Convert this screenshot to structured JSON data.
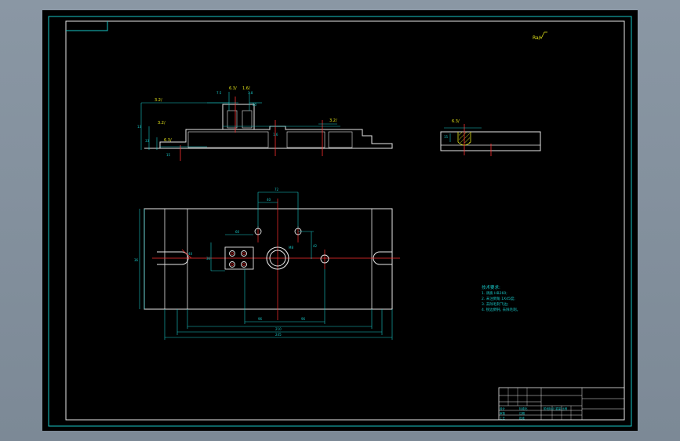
{
  "drawing": {
    "roughness_note": "Ra/",
    "section": {
      "dims": [
        "7.5",
        "3.8",
        "13",
        "33",
        "15",
        "20",
        "1.6"
      ],
      "roughness": [
        "3.2/",
        "3.2/",
        "6.3/",
        "6.3/",
        "1.6/",
        "3.2/"
      ]
    },
    "side_view": {
      "roughness": "6.3/",
      "dim": "15"
    },
    "plan": {
      "dims_top": [
        "72",
        "40"
      ],
      "dims_left": [
        "36",
        "36",
        "60"
      ],
      "dims_right": [
        "42"
      ],
      "dims_bottom": [
        "96",
        "96",
        "210",
        "245"
      ],
      "hole_labels": [
        "4X",
        "M8"
      ]
    },
    "notes": {
      "title": "技术要求:",
      "items": [
        "1. 调质 HB260;",
        "2. 未注倒角 1X45度;",
        "3. 去除毛刺飞边;",
        "4. 锐边倒钝, 去除毛刺。"
      ]
    },
    "title_block": {
      "labels": [
        "设计",
        "审核",
        "工艺",
        "标准化",
        "批准",
        "日期"
      ],
      "part": "阶段标记  重量  比例"
    }
  }
}
